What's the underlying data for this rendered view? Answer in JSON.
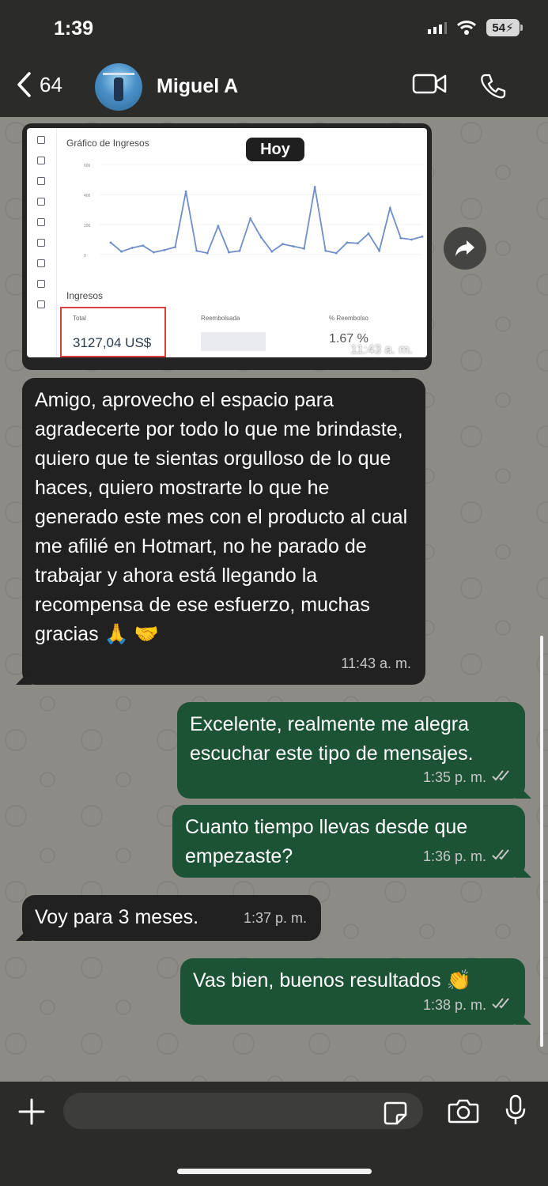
{
  "status": {
    "time": "1:39",
    "battery": "54"
  },
  "header": {
    "unread_count": "64",
    "contact_name": "Miguel A"
  },
  "image_message": {
    "chart_title": "Gráfico de Ingresos",
    "date_badge": "Hoy",
    "section_label": "Ingresos",
    "total_label": "Total",
    "total_value": "3127,04 US$",
    "refund_label": "Reembolsada",
    "refund_rate_label": "% Reembolso",
    "refund_rate_value": "1.67 %",
    "time": "11:43 a. m."
  },
  "messages": [
    {
      "direction": "incoming",
      "text": "Amigo, aprovecho el espacio para agradecerte por todo lo que me brindaste, quiero que te sientas orgulloso de lo que haces, quiero mostrarte lo que he generado este mes con el producto al cual me afilié en Hotmart, no he parado de trabajar y ahora está llegando la recompensa de ese esfuerzo, muchas gracias 🙏 🤝",
      "time": "11:43 a. m."
    },
    {
      "direction": "outgoing",
      "text": "Excelente, realmente me alegra escuchar este tipo de mensajes.",
      "time": "1:35 p. m."
    },
    {
      "direction": "outgoing",
      "text": "Cuanto tiempo llevas desde que empezaste?",
      "time": "1:36 p. m."
    },
    {
      "direction": "incoming",
      "text": "Voy para 3 meses.",
      "time": "1:37 p. m."
    },
    {
      "direction": "outgoing",
      "text": "Vas bien, buenos resultados 👏",
      "time": "1:38 p. m."
    }
  ],
  "chart_data": {
    "type": "line",
    "title": "Gráfico de Ingresos",
    "ylim": [
      0,
      600
    ],
    "yticks": [
      "600",
      "400",
      "200",
      "0"
    ],
    "values": [
      80,
      20,
      45,
      60,
      15,
      30,
      50,
      420,
      25,
      10,
      190,
      15,
      25,
      240,
      115,
      20,
      70,
      55,
      40,
      450,
      25,
      10,
      80,
      75,
      140,
      25,
      310,
      110,
      100,
      120
    ]
  }
}
